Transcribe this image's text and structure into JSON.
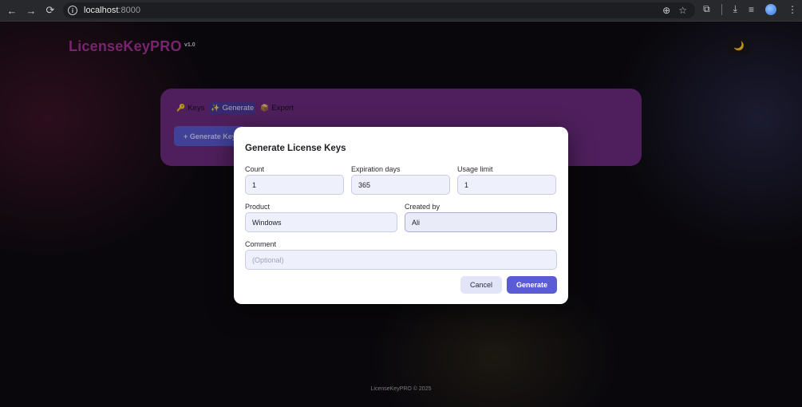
{
  "browser": {
    "back_icon": "←",
    "forward_icon": "→",
    "reload_icon": "⟳",
    "url_host": "localhost",
    "url_port": ":8000",
    "zoom_icon": "⊕",
    "bookmark_icon": "☆",
    "extensions_icon": "⧉",
    "download_icon": "⤓",
    "media_icon": "≡",
    "menu_icon": "⋮"
  },
  "app": {
    "logo": "LicenseKeyPRO",
    "version": "v1.0",
    "theme_icon": "🌙"
  },
  "tabs": [
    {
      "icon": "🔑",
      "label": "Keys"
    },
    {
      "icon": "✨",
      "label": "Generate"
    },
    {
      "icon": "📦",
      "label": "Export"
    }
  ],
  "card": {
    "generate_button": "+ Generate Keys"
  },
  "modal": {
    "title": "Generate License Keys",
    "count_label": "Count",
    "count_value": "1",
    "expiration_label": "Expiration days",
    "expiration_value": "365",
    "usage_label": "Usage limit",
    "usage_value": "1",
    "product_label": "Product",
    "product_value": "Windows",
    "created_by_label": "Created by",
    "created_by_value": "Ali",
    "comment_label": "Comment",
    "comment_placeholder": "(Optional)",
    "cancel_label": "Cancel",
    "generate_label": "Generate"
  },
  "footer": {
    "text": "LicenseKeyPRO © 2025"
  }
}
